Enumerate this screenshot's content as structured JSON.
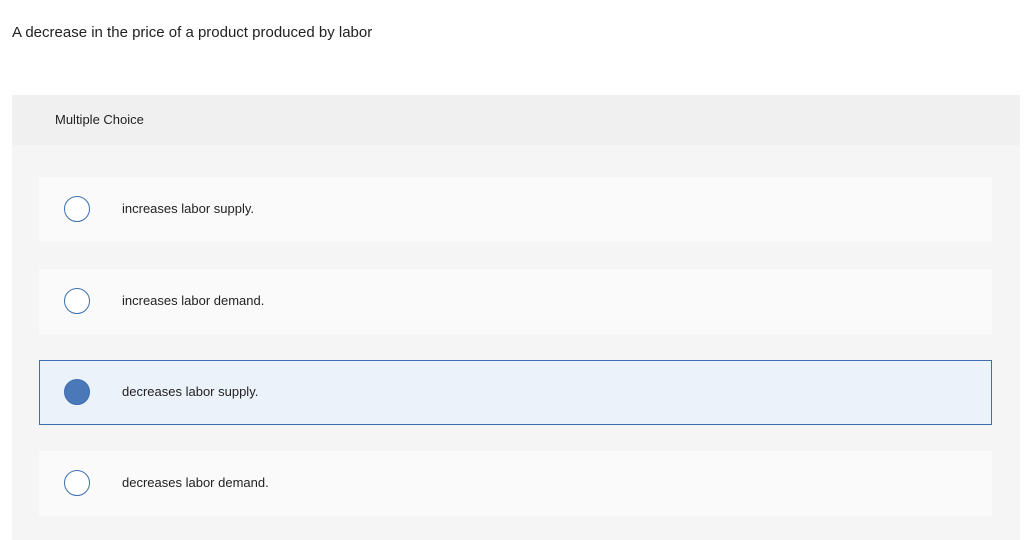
{
  "question": {
    "text": "A decrease in the price of a product produced by labor"
  },
  "multiple_choice": {
    "header_label": "Multiple Choice",
    "options": [
      {
        "label": "increases labor supply.",
        "selected": false
      },
      {
        "label": "increases labor demand.",
        "selected": false
      },
      {
        "label": "decreases labor supply.",
        "selected": true
      },
      {
        "label": "decreases labor demand.",
        "selected": false
      }
    ]
  },
  "colors": {
    "accent": "#3d6fb0",
    "selected_fill": "#4a78b8",
    "selected_bg": "#ebf2fa",
    "panel_bg": "#f5f5f5",
    "option_bg": "#fafafa"
  }
}
